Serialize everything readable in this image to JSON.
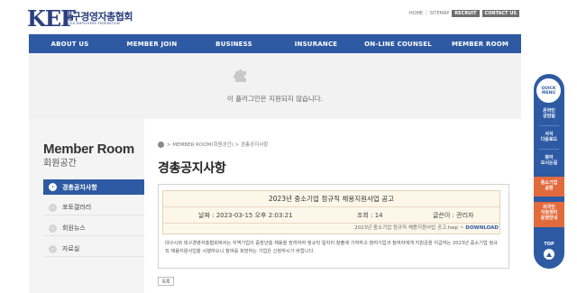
{
  "header": {
    "logo_mark": "KEF",
    "logo_korean": "대구경영자총협회",
    "logo_english": "DAEGU EMPLOYERS FEDERATION",
    "util_links": [
      "HOME",
      "SITEMAP"
    ],
    "util_buttons": [
      "RECRUIT",
      "CONTACT US"
    ]
  },
  "nav": {
    "items": [
      "ABOUT US",
      "MEMBER JOIN",
      "BUSINESS",
      "INSURANCE",
      "ON-LINE COUNSEL",
      "MEMBER ROOM"
    ]
  },
  "plugin": {
    "message": "이 플러그인은 지원되지 않습니다."
  },
  "sidebar": {
    "title": "Member Room",
    "subtitle": "회원공간",
    "items": [
      "경총공지사항",
      "포토갤러리",
      "회원뉴스",
      "자료실"
    ],
    "active_index": 0
  },
  "breadcrumb": {
    "text": "> MEMBER ROOM(회원공간) > 경총공지사항"
  },
  "page": {
    "title": "경총공지사항"
  },
  "post": {
    "title": "2023년 중소기업 정규직 채용지원사업 공고",
    "date_label": "날짜 : 2023-03-15 오후 2:03:21",
    "views_label": "조회 : 14",
    "author_label": "글쓴이 : 관리자",
    "file_name": "2023년 중소기업 정규직 채용지원사업 공고.hwp ~",
    "download_label": "DOWNLOAD",
    "body": "대구시와 대구경영자총협회에서는 지역기업의 중장년층 채용을 장려하여 정규직 일자리 창출에 기여하고 참여기업과 참여자에게 지원금을 지급하는 2023년 중소기업 정규직 채용지원사업을 시행하오니 참여를 희망하는 기업은 신청하시기 바랍니다."
  },
  "list_button": "목록",
  "quick_menu": {
    "head": [
      "QUICK",
      "MENU"
    ],
    "items": [
      [
        "온라인",
        "상담실"
      ],
      [
        "서식",
        "다운로드"
      ],
      [
        "찾아",
        "오시는길"
      ],
      [
        "중소기업",
        "공환"
      ],
      [
        "외국인",
        "지원센터",
        "운영안내"
      ]
    ],
    "top_label": "TOP"
  },
  "colors": {
    "brand_blue": "#2e5aa3",
    "quick_highlight": "#e26b3d"
  }
}
